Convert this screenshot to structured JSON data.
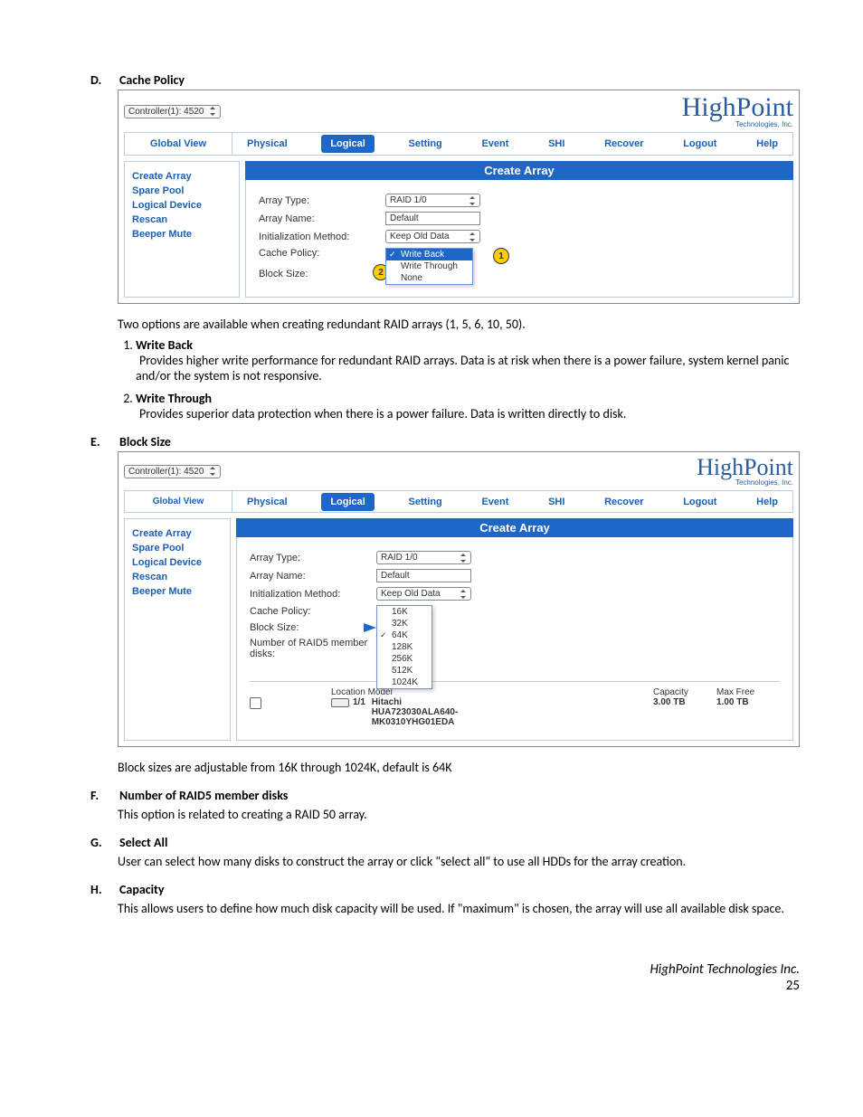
{
  "sections": {
    "D": {
      "letter": "D.",
      "title": "Cache Policy"
    },
    "E": {
      "letter": "E.",
      "title": "Block Size"
    },
    "F": {
      "letter": "F.",
      "title": "Number of RAID5 member disks",
      "body": "This option is related to creating a RAID 50 array."
    },
    "G": {
      "letter": "G.",
      "title": "Select All",
      "body": "User can select how many disks to construct the array or click \"select all\" to use all HDDs for the array creation."
    },
    "H": {
      "letter": "H.",
      "title": "Capacity",
      "body": "This allows users to define how much disk capacity will be used. If \"maximum\" is chosen, the array will use all available disk space."
    }
  },
  "body": {
    "d_intro": "Two options are available when creating redundant RAID arrays (1, 5, 6, 10, 50).",
    "wb_title": "Write Back",
    "wb_body": "Provides higher write performance for redundant RAID arrays. Data is at risk when there is a power failure, system kernel panic and/or the system is not responsive.",
    "wt_title": "Write Through",
    "wt_body": "Provides superior data protection when there is a power failure. Data is written directly to disk.",
    "e_body": "Block sizes are adjustable from 16K through 1024K, default is 64K"
  },
  "app": {
    "controller": "Controller(1): 4520",
    "logo": "HighPoint",
    "logo_sub": "Technologies, Inc.",
    "global_view": "Global View",
    "tabs": [
      "Physical",
      "Logical",
      "Setting",
      "Event",
      "SHI",
      "Recover",
      "Logout",
      "Help"
    ],
    "panel_title": "Create Array",
    "sidebar": [
      "Create Array",
      "Spare Pool",
      "Logical Device",
      "Rescan",
      "Beeper Mute"
    ],
    "labels": {
      "array_type": "Array Type:",
      "array_name": "Array Name:",
      "init_method": "Initialization Method:",
      "cache_policy": "Cache Policy:",
      "block_size": "Block Size:",
      "raid5_members": "Number of RAID5 member disks:"
    },
    "values": {
      "raid_type": "RAID 1/0",
      "array_name": "Default",
      "init_method": "Keep Old Data"
    },
    "cache_menu": {
      "write_back": "Write Back",
      "write_through": "Write Through",
      "none": "None"
    },
    "callout1": "1",
    "callout2": "2",
    "block_menu": [
      "16K",
      "32K",
      "64K",
      "128K",
      "256K",
      "512K",
      "1024K"
    ],
    "table": {
      "h_location": "Location",
      "h_model": "Model",
      "h_capacity": "Capacity",
      "h_maxfree": "Max Free",
      "row": {
        "loc": "1/1",
        "model_top": "Hitachi",
        "model_mid": "HUA723030ALA640-",
        "model_bot": "MK0310YHG01EDA",
        "capacity": "3.00 TB",
        "maxfree": "1.00 TB"
      }
    }
  },
  "footer": {
    "company": "HighPoint Technologies Inc.",
    "page": "25"
  }
}
